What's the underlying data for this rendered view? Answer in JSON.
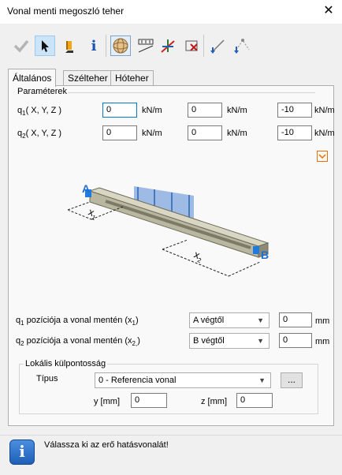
{
  "window": {
    "title": "Vonal menti megoszló teher",
    "close": "✕"
  },
  "toolbar": {
    "items": [
      "check-icon",
      "pointer-icon",
      "load-marker-icon",
      "info-icon",
      "sphere-icon",
      "distribute-icon",
      "axes-icon",
      "delete-cross-icon",
      "arrow-down-icon",
      "node-arrow-icon"
    ]
  },
  "tabs": [
    {
      "label": "Általános",
      "active": true
    },
    {
      "label": "Szélteher",
      "active": false
    },
    {
      "label": "Hóteher",
      "active": false
    }
  ],
  "params": {
    "title": "Paraméterek",
    "unit": "kN/m",
    "q1": {
      "label_pre": "q",
      "label_sub": "1",
      "label_post": "( X, Y, Z )",
      "x": "0",
      "y": "0",
      "z": "-10"
    },
    "q2": {
      "label_pre": "q",
      "label_sub": "2",
      "label_post": "( X, Y, Z )",
      "x": "0",
      "y": "0",
      "z": "-10"
    }
  },
  "diagram": {
    "label_a": "A",
    "label_b": "B",
    "label_x1": "x",
    "sub_x1": "1",
    "label_x2": "x",
    "sub_x2": "2"
  },
  "positions": {
    "unit": "mm",
    "pos1": {
      "label_pre": "q",
      "label_sub": "1",
      "label_mid": " pozíciója a vonal mentén (x",
      "label_sub2": "1",
      "label_end": ")",
      "select": "A végtől",
      "value": "0"
    },
    "pos2": {
      "label_pre": "q",
      "label_sub": "2",
      "label_mid": " pozíciója a vonal mentén (x",
      "label_sub2": "2,",
      "label_end": ")",
      "select": "B végtől",
      "value": "0"
    }
  },
  "eccentricity": {
    "title": "Lokális külpontosság",
    "type_label": "Típus",
    "type_value": "0 - Referencia vonal",
    "browse": "...",
    "y_label": "y [mm]",
    "y_value": "0",
    "z_label": "z [mm]",
    "z_value": "0"
  },
  "status": {
    "message": "Válassza ki az erő hatásvonalát!",
    "icon_letter": "i"
  }
}
